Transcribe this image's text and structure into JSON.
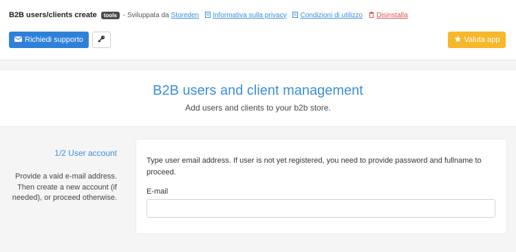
{
  "header": {
    "app_title": "B2B users/clients create",
    "badge": "tools",
    "developed_by": "- Sviluppata da",
    "developer_link": "Storeden",
    "privacy_link": "Informativa sulla privacy",
    "terms_link": "Condizioni di utilizzo",
    "uninstall_link": "Disinstalla",
    "support_button": "Richiedi supporto",
    "rate_button": "Valuta app"
  },
  "hero": {
    "title": "B2B users and client management",
    "subtitle": "Add users and clients to your b2b store."
  },
  "step": {
    "title": "1/2 User account",
    "description": "Provide a vaid e-mail address. Then create a new account (if needed), or proceed otherwise."
  },
  "form": {
    "instructions": "Type user email address. If user is not yet registered, you need to provide password and fullname to proceed.",
    "email_label": "E-mail",
    "email_value": ""
  },
  "colors": {
    "primary": "#2f81d8",
    "accent_link": "#3b8fd9",
    "rate": "#f7b72b",
    "danger": "#d9534f"
  }
}
